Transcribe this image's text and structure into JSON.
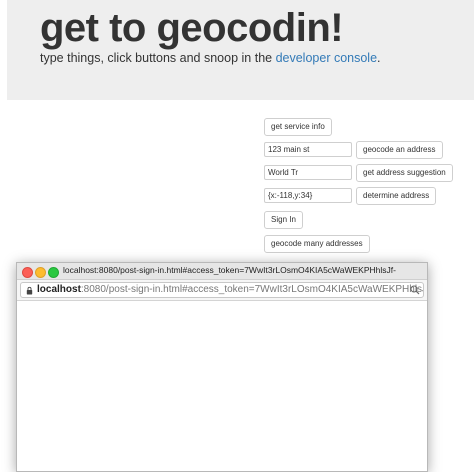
{
  "header": {
    "title": "get to geocodin!",
    "subtitle_prefix": "type things, click buttons and snoop in the ",
    "subtitle_link": "developer console",
    "subtitle_suffix": "."
  },
  "controls": {
    "service_info_button": "get service info",
    "address_input": "123 main st",
    "geocode_button": "geocode an address",
    "suggest_input": "World Tr",
    "suggest_button": "get address suggestion",
    "location_input": "{x:-118,y:34}",
    "reverse_button": "determine address",
    "sign_in_button": "Sign In",
    "batch_button": "geocode many addresses"
  },
  "popup": {
    "title": "localhost:8080/post-sign-in.html#access_token=7WwIt3rLOsmO4KIA5cWaWEKPHhlsJf-",
    "url_host": "localhost",
    "url_rest": ":8080/post-sign-in.html#access_token=7WwIt3rLOsmO4KIA5cWaWEKPHhlsJf-",
    "icons": [
      "lock-icon",
      "search-icon"
    ]
  },
  "colors": {
    "link": "#337ab7",
    "jumbotron_bg": "#eeeeee",
    "close": "#fc5f57",
    "minimize": "#fdbc2e",
    "zoom": "#29c840"
  }
}
